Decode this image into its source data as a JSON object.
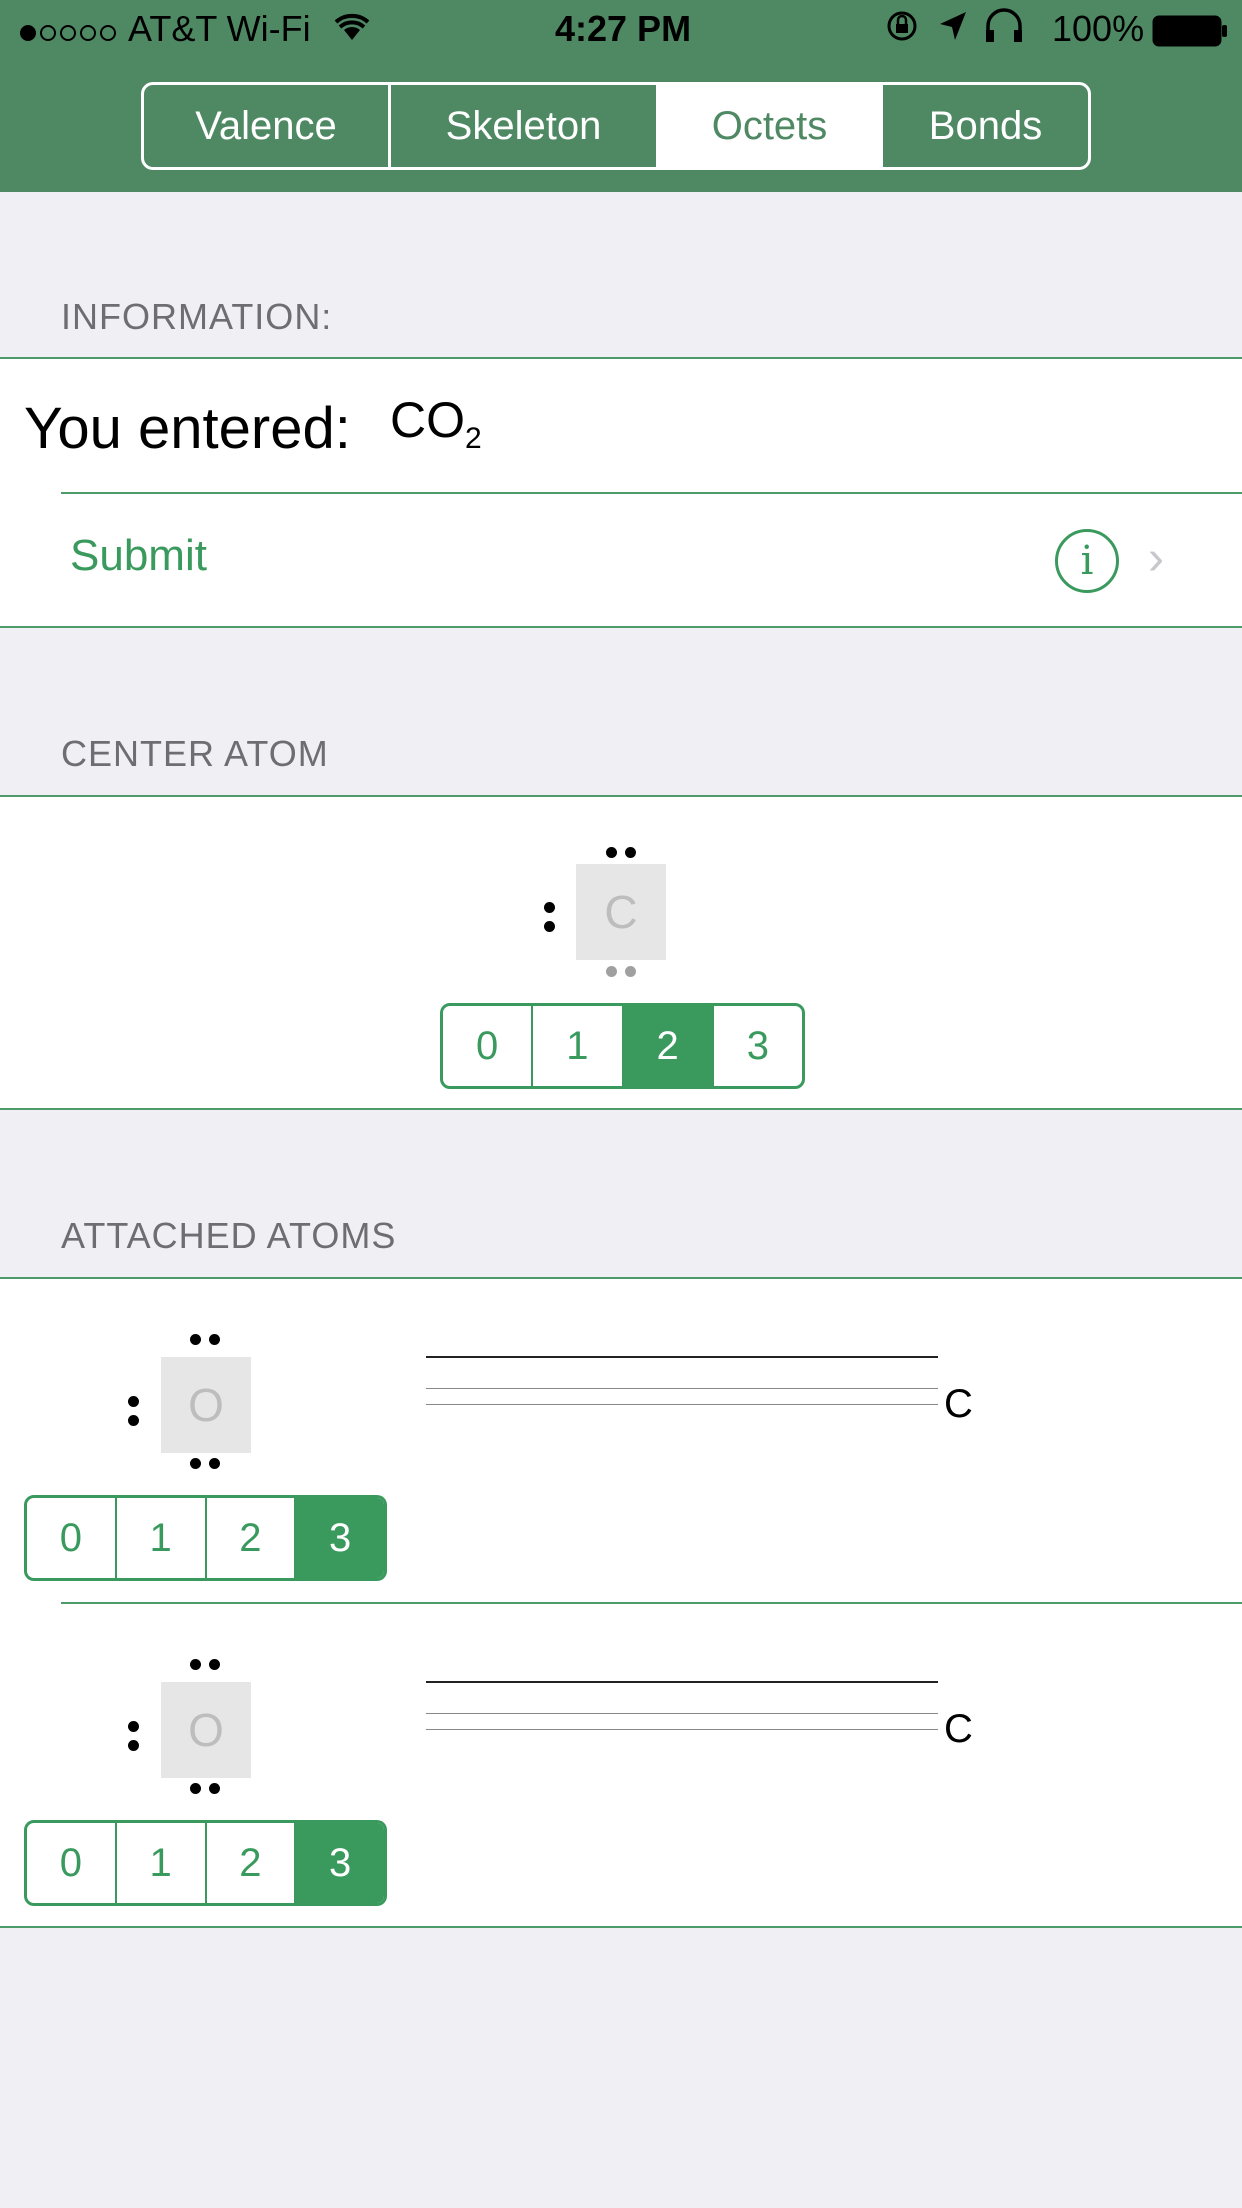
{
  "status_bar": {
    "carrier": "AT&T Wi-Fi",
    "time": "4:27 PM",
    "battery": "100%",
    "signal_dots_filled": 1,
    "signal_dots_total": 5
  },
  "tabs": [
    {
      "label": "Valence",
      "selected": false
    },
    {
      "label": "Skeleton",
      "selected": false
    },
    {
      "label": "Octets",
      "selected": true
    },
    {
      "label": "Bonds",
      "selected": false
    }
  ],
  "information": {
    "section_label": "INFORMATION:",
    "entered_label": "You entered:",
    "formula_main": "CO",
    "formula_sub": "2",
    "submit_label": "Submit",
    "info_icon": "i",
    "chevron": "›"
  },
  "center_atom": {
    "section_label": "CENTER ATOM",
    "symbol": "C",
    "options": [
      "0",
      "1",
      "2",
      "3"
    ],
    "selected": "2"
  },
  "attached_atoms": {
    "section_label": "ATTACHED ATOMS",
    "atoms": [
      {
        "symbol": "O",
        "bond_to": "C",
        "options": [
          "0",
          "1",
          "2",
          "3"
        ],
        "selected": "3"
      },
      {
        "symbol": "O",
        "bond_to": "C",
        "options": [
          "0",
          "1",
          "2",
          "3"
        ],
        "selected": "3"
      }
    ]
  },
  "colors": {
    "header": "#4f8964",
    "accent": "#3a9a5e",
    "background": "#efeff4"
  }
}
